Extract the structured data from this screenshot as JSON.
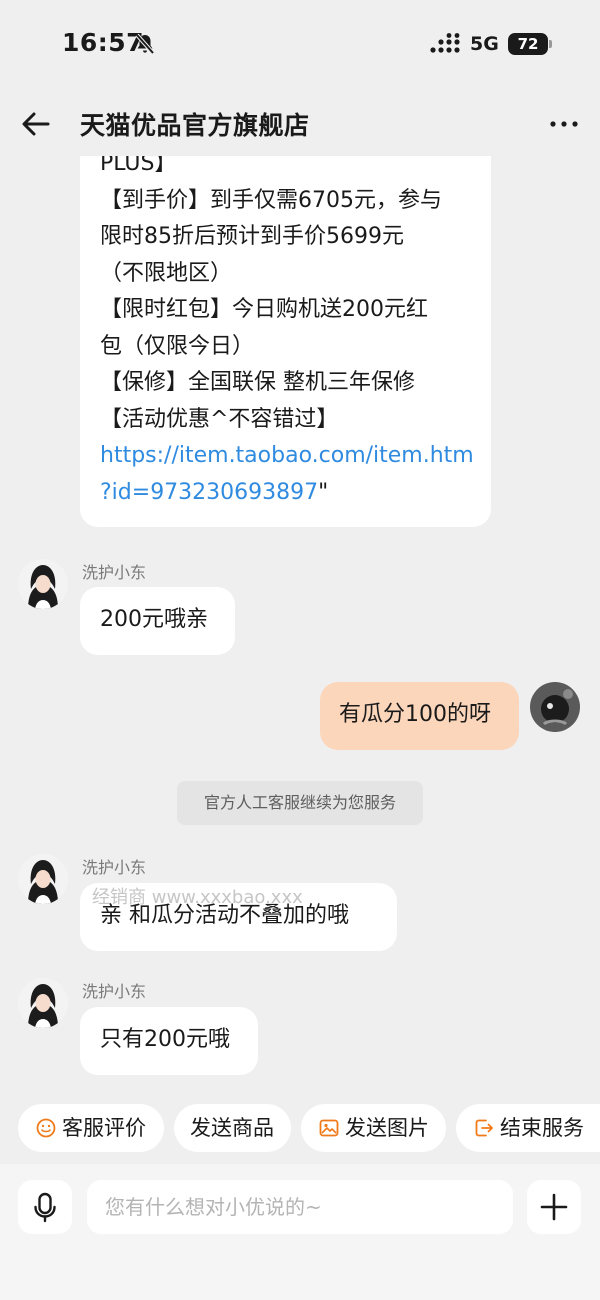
{
  "status_bar": {
    "time": "16:57",
    "network": "5G",
    "battery": "72"
  },
  "header": {
    "title": "天猫优品官方旗舰店"
  },
  "product_message": {
    "lines": [
      "PLUS】",
      "【到手价】到手仅需6705元，参与",
      "限时85折后预计到手价5699元",
      "（不限地区）",
      "【限时红包】今日购机送200元红",
      "包（仅限今日）",
      "【保修】全国联保  整机三年保修",
      "【活动优惠^不容错过】"
    ],
    "link_line1": "https://item.taobao.com/item.htm",
    "link_line2": "?id=973230693897",
    "link_suffix": "\""
  },
  "messages": [
    {
      "sender": "洗护小东",
      "text": "200元哦亲"
    },
    {
      "sender": "me",
      "text": "有瓜分100的呀"
    },
    {
      "sender": "洗护小东",
      "text": "亲  和瓜分活动不叠加的哦"
    },
    {
      "sender": "洗护小东",
      "text": "只有200元哦"
    }
  ],
  "system_tip": "官方人工客服继续为您服务",
  "watermark": "经销商 www.xxxbao.xxx",
  "quick_actions": [
    {
      "label": "客服评价",
      "icon": "smile-icon"
    },
    {
      "label": "发送商品",
      "icon": ""
    },
    {
      "label": "发送图片",
      "icon": "image-icon"
    },
    {
      "label": "结束服务",
      "icon": "exit-icon"
    }
  ],
  "input": {
    "placeholder": "您有什么想对小优说的~"
  },
  "colors": {
    "link": "#2f8be0",
    "self_bubble": "#fbd6bb",
    "accent_orange": "#f07a1a"
  }
}
